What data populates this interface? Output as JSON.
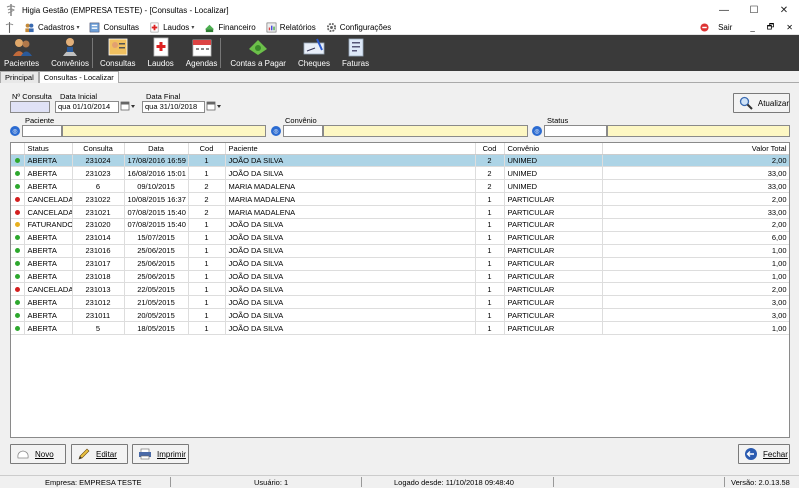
{
  "window": {
    "title": "Higia Gestão (EMPRESA TESTE) - [Consultas - Localizar]",
    "minimize": "—",
    "maximize": "☐",
    "close": "✕"
  },
  "menu": {
    "items": [
      {
        "label": "Cadastros",
        "icon": "people-icon",
        "has_arrow": true
      },
      {
        "label": "Consultas",
        "icon": "consultas-icon",
        "has_arrow": false
      },
      {
        "label": "Laudos",
        "icon": "laudos-icon",
        "has_arrow": true
      },
      {
        "label": "Financeiro",
        "icon": "money-icon",
        "has_arrow": false
      },
      {
        "label": "Relatórios",
        "icon": "report-icon",
        "has_arrow": false
      },
      {
        "label": "Configurações",
        "icon": "gear-icon",
        "has_arrow": false
      }
    ],
    "sair": "Sair",
    "mdi_min": "_",
    "mdi_restore": "🗗",
    "mdi_close": "✕"
  },
  "toolbar": {
    "pacientes": "Pacientes",
    "convenios": "Convênios",
    "consultas": "Consultas",
    "laudos": "Laudos",
    "agendas": "Agendas",
    "contas_pagar": "Contas a Pagar",
    "cheques": "Cheques",
    "faturas": "Faturas"
  },
  "tabs": [
    "Principal",
    "Consultas - Localizar"
  ],
  "filters": {
    "num_consulta_label": "Nº Consulta",
    "num_consulta_value": "",
    "data_inicial_label": "Data Inicial",
    "data_inicial_value": "qua 01/10/2014",
    "data_final_label": "Data Final",
    "data_final_value": "qua 31/10/2018",
    "paciente_label": "Paciente",
    "convenio_label": "Convênio",
    "status_label": "Status",
    "atualizar": "Atualizar"
  },
  "grid": {
    "columns": [
      "Status",
      "Consulta",
      "Data",
      "Cod",
      "Paciente",
      "Cod",
      "Convênio",
      "Valor Total"
    ],
    "rows": [
      {
        "status": "ABERTA",
        "color": "#2ea82e",
        "consulta": "231024",
        "data": "17/08/2016 16:59",
        "cod": "1",
        "paciente": "JOÃO DA SILVA",
        "cod2": "2",
        "convenio": "UNIMED",
        "valor": "2,00"
      },
      {
        "status": "ABERTA",
        "color": "#2ea82e",
        "consulta": "231023",
        "data": "16/08/2016 15:01",
        "cod": "1",
        "paciente": "JOÃO DA SILVA",
        "cod2": "2",
        "convenio": "UNIMED",
        "valor": "33,00"
      },
      {
        "status": "ABERTA",
        "color": "#2ea82e",
        "consulta": "6",
        "data": "09/10/2015",
        "cod": "2",
        "paciente": "MARIA MADALENA",
        "cod2": "2",
        "convenio": "UNIMED",
        "valor": "33,00"
      },
      {
        "status": "CANCELADA",
        "color": "#d42020",
        "consulta": "231022",
        "data": "10/08/2015 16:37",
        "cod": "2",
        "paciente": "MARIA MADALENA",
        "cod2": "1",
        "convenio": "PARTICULAR",
        "valor": "2,00"
      },
      {
        "status": "CANCELADA",
        "color": "#d42020",
        "consulta": "231021",
        "data": "07/08/2015 15:40",
        "cod": "2",
        "paciente": "MARIA MADALENA",
        "cod2": "1",
        "convenio": "PARTICULAR",
        "valor": "33,00"
      },
      {
        "status": "FATURANDO",
        "color": "#e8b020",
        "consulta": "231020",
        "data": "07/08/2015 15:40",
        "cod": "1",
        "paciente": "JOÃO DA SILVA",
        "cod2": "1",
        "convenio": "PARTICULAR",
        "valor": "2,00"
      },
      {
        "status": "ABERTA",
        "color": "#2ea82e",
        "consulta": "231014",
        "data": "15/07/2015",
        "cod": "1",
        "paciente": "JOÃO DA SILVA",
        "cod2": "1",
        "convenio": "PARTICULAR",
        "valor": "6,00"
      },
      {
        "status": "ABERTA",
        "color": "#2ea82e",
        "consulta": "231016",
        "data": "25/06/2015",
        "cod": "1",
        "paciente": "JOÃO DA SILVA",
        "cod2": "1",
        "convenio": "PARTICULAR",
        "valor": "1,00"
      },
      {
        "status": "ABERTA",
        "color": "#2ea82e",
        "consulta": "231017",
        "data": "25/06/2015",
        "cod": "1",
        "paciente": "JOÃO DA SILVA",
        "cod2": "1",
        "convenio": "PARTICULAR",
        "valor": "1,00"
      },
      {
        "status": "ABERTA",
        "color": "#2ea82e",
        "consulta": "231018",
        "data": "25/06/2015",
        "cod": "1",
        "paciente": "JOÃO DA SILVA",
        "cod2": "1",
        "convenio": "PARTICULAR",
        "valor": "1,00"
      },
      {
        "status": "CANCELADA",
        "color": "#d42020",
        "consulta": "231013",
        "data": "22/05/2015",
        "cod": "1",
        "paciente": "JOÃO DA SILVA",
        "cod2": "1",
        "convenio": "PARTICULAR",
        "valor": "2,00"
      },
      {
        "status": "ABERTA",
        "color": "#2ea82e",
        "consulta": "231012",
        "data": "21/05/2015",
        "cod": "1",
        "paciente": "JOÃO DA SILVA",
        "cod2": "1",
        "convenio": "PARTICULAR",
        "valor": "3,00"
      },
      {
        "status": "ABERTA",
        "color": "#2ea82e",
        "consulta": "231011",
        "data": "20/05/2015",
        "cod": "1",
        "paciente": "JOÃO DA SILVA",
        "cod2": "1",
        "convenio": "PARTICULAR",
        "valor": "3,00"
      },
      {
        "status": "ABERTA",
        "color": "#2ea82e",
        "consulta": "5",
        "data": "18/05/2015",
        "cod": "1",
        "paciente": "JOÃO DA SILVA",
        "cod2": "1",
        "convenio": "PARTICULAR",
        "valor": "1,00"
      }
    ]
  },
  "buttons": {
    "novo": "Novo",
    "editar": "Editar",
    "imprimir": "Imprimir",
    "fechar": "Fechar"
  },
  "statusbar": {
    "empresa": "Empresa: EMPRESA TESTE",
    "usuario": "Usuário: 1",
    "logado": "Logado desde: 11/10/2018 09:48:40",
    "versao": "Versão: 2.0.13.58"
  }
}
